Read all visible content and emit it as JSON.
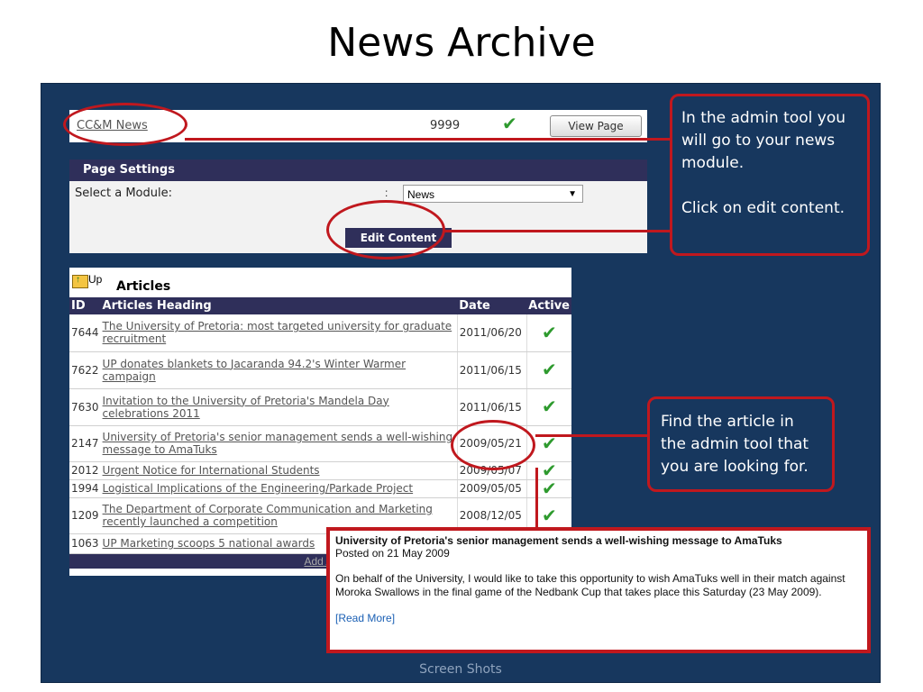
{
  "slide": {
    "title": "News Archive",
    "footer": "Screen Shots"
  },
  "module_row": {
    "link": "CC&M News",
    "count": "9999",
    "view_button": "View Page"
  },
  "page_settings": {
    "header": "Page Settings",
    "select_label": "Select a Module:",
    "colon": ":",
    "selected_module": "News",
    "edit_button": "Edit Content"
  },
  "articles": {
    "up_label": "Up",
    "title": "Articles",
    "columns": [
      "ID",
      "Articles Heading",
      "Date",
      "Active"
    ],
    "rows": [
      {
        "id": "7644",
        "heading": "The University of Pretoria: most targeted university for graduate recruitment",
        "date": "2011/06/20"
      },
      {
        "id": "7622",
        "heading": "UP donates blankets to Jacaranda 94.2's Winter Warmer campaign",
        "date": "2011/06/15"
      },
      {
        "id": "7630",
        "heading": "Invitation to the University of Pretoria's Mandela Day celebrations 2011",
        "date": "2011/06/15"
      },
      {
        "id": "2147",
        "heading": "University of Pretoria's senior management sends a well-wishing message to AmaTuks",
        "date": "2009/05/21"
      },
      {
        "id": "2012",
        "heading": "Urgent Notice for International Students",
        "date": "2009/05/07"
      },
      {
        "id": "1994",
        "heading": "Logistical Implications of the Engineering/Parkade Project",
        "date": "2009/05/05"
      },
      {
        "id": "1209",
        "heading": "The Department of Corporate Communication and Marketing recently launched a competition",
        "date": "2008/12/05"
      },
      {
        "id": "1063",
        "heading": "UP Marketing scoops 5 national awards",
        "date": ""
      }
    ],
    "add_link": "Add Ar"
  },
  "callouts": {
    "admin": "In the admin tool you will go to your news module.\n\nClick on edit content.",
    "find": "Find the article in the admin tool that you are looking for."
  },
  "popup": {
    "title": "University of Pretoria's senior management sends a well-wishing message to AmaTuks",
    "posted": "Posted on 21 May 2009",
    "body": "On behalf of the University, I would like to take this opportunity to wish AmaTuks well in their match against Moroka Swallows in the final game of the Nedbank Cup that takes place this Saturday (23 May 2009).",
    "read_more": "[Read More]"
  },
  "colors": {
    "panel": "#17375e",
    "highlight": "#c0181e",
    "header_bar": "#2f2f5a",
    "check": "#2e9a2e"
  },
  "icons": {
    "active": "check-icon",
    "up": "folder-up-icon",
    "dropdown": "chevron-down-icon"
  }
}
